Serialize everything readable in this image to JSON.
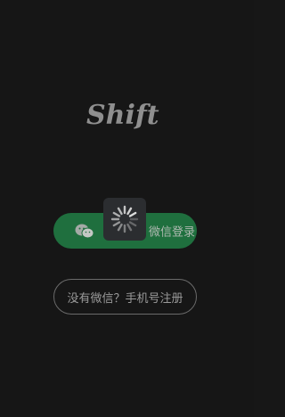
{
  "app": {
    "logo_text": "Shift"
  },
  "login": {
    "wechat_label": "微信登录",
    "wechat_label_visible": "登录",
    "phone_label": "没有微信？手机号注册"
  },
  "colors": {
    "background": "#161616",
    "wechat_green": "#1f6f3e",
    "spinner_bg": "#2b2d30",
    "phone_border": "#6b6b6b"
  },
  "icons": {
    "wechat": "wechat-icon",
    "spinner": "loading-spinner-icon"
  }
}
